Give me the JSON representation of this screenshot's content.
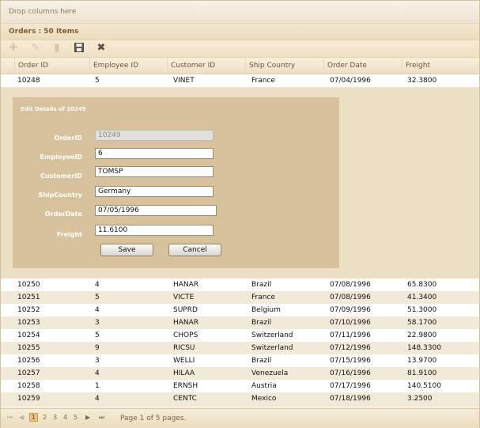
{
  "group_panel": {
    "text": "Drop columns here"
  },
  "title_bar": {
    "text": "Orders : 50 Items"
  },
  "toolbar": {
    "icons": [
      "add-icon",
      "edit-icon",
      "delete-icon",
      "save-icon",
      "cancel-icon"
    ]
  },
  "columns": [
    "Order ID",
    "Employee ID",
    "Customer ID",
    "Ship Country",
    "Order Date",
    "Freight"
  ],
  "rows_before": [
    [
      "10248",
      "5",
      "VINET",
      "France",
      "07/04/1996",
      "32.3800"
    ]
  ],
  "edit_form": {
    "title": "Edit Details of 10249",
    "labels": {
      "order_id": "OrderID",
      "employee_id": "EmployeeID",
      "customer_id": "CustomerID",
      "ship_country": "ShipCountry",
      "order_date": "OrderDate",
      "freight": "Freight"
    },
    "values": {
      "order_id": "10249",
      "employee_id": "6",
      "customer_id": "TOMSP",
      "ship_country": "Germany",
      "order_date": "07/05/1996",
      "freight": "11.6100"
    },
    "save_label": "Save",
    "cancel_label": "Cancel"
  },
  "rows_after": [
    [
      "10250",
      "4",
      "HANAR",
      "Brazil",
      "07/08/1996",
      "65.8300"
    ],
    [
      "10251",
      "5",
      "VICTE",
      "France",
      "07/08/1996",
      "41.3400"
    ],
    [
      "10252",
      "4",
      "SUPRD",
      "Belgium",
      "07/09/1996",
      "51.3000"
    ],
    [
      "10253",
      "3",
      "HANAR",
      "Brazil",
      "07/10/1996",
      "58.1700"
    ],
    [
      "10254",
      "5",
      "CHOPS",
      "Switzerland",
      "07/11/1996",
      "22.9800"
    ],
    [
      "10255",
      "9",
      "RICSU",
      "Switzerland",
      "07/12/1996",
      "148.3300"
    ],
    [
      "10256",
      "3",
      "WELLI",
      "Brazil",
      "07/15/1996",
      "13.9700"
    ],
    [
      "10257",
      "4",
      "HILAA",
      "Venezuela",
      "07/16/1996",
      "81.9100"
    ],
    [
      "10258",
      "1",
      "ERNSH",
      "Austria",
      "07/17/1996",
      "140.5100"
    ],
    [
      "10259",
      "4",
      "CENTC",
      "Mexico",
      "07/18/1996",
      "3.2500"
    ]
  ],
  "pager": {
    "first": "⏮",
    "prev": "◀",
    "pages": [
      "1",
      "2",
      "3",
      "4",
      "5"
    ],
    "current_page": "1",
    "next": "▶",
    "last": "⏭",
    "info": "Page 1 of 5 pages."
  }
}
